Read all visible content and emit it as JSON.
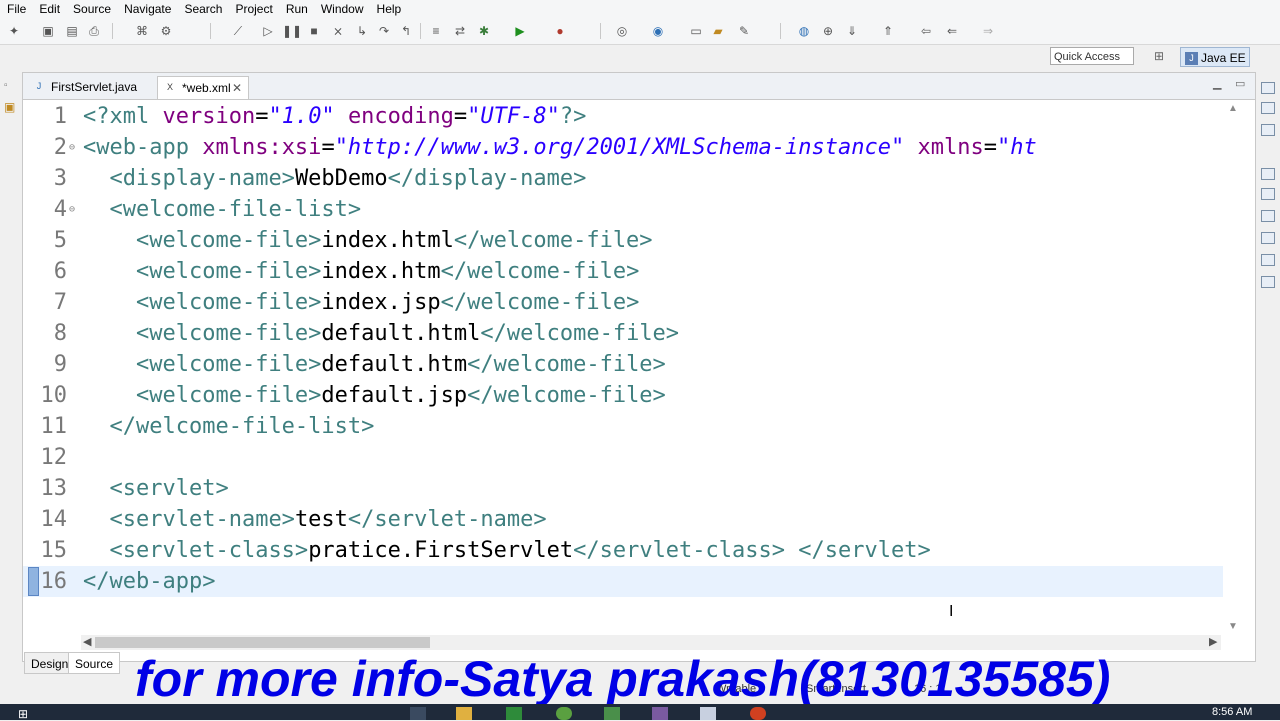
{
  "menu": [
    "File",
    "Edit",
    "Source",
    "Navigate",
    "Search",
    "Project",
    "Run",
    "Window",
    "Help"
  ],
  "toolbar": {
    "quick_access": "Quick Access",
    "perspective": "Java EE",
    "perspective_icon": "J"
  },
  "editor": {
    "tabs": [
      {
        "label": "FirstServlet.java",
        "icon": "java-file-icon",
        "active": false
      },
      {
        "label": "*web.xml",
        "icon": "xml-file-icon",
        "active": true
      }
    ],
    "lines": [
      {
        "n": "1",
        "tokens": [
          [
            "pi",
            "<?xml "
          ],
          [
            "a",
            "version"
          ],
          [
            "tx",
            "="
          ],
          [
            "v",
            "\"1.0\""
          ],
          [
            "tx",
            " "
          ],
          [
            "a",
            "encoding"
          ],
          [
            "tx",
            "="
          ],
          [
            "v",
            "\"UTF-8\""
          ],
          [
            "pi",
            "?>"
          ]
        ]
      },
      {
        "n": "2",
        "tokens": [
          [
            "t",
            "<web-app "
          ],
          [
            "a",
            "xmlns:xsi"
          ],
          [
            "tx",
            "="
          ],
          [
            "v",
            "\"http://www.w3.org/2001/XMLSchema-instance\""
          ],
          [
            "tx",
            " "
          ],
          [
            "a",
            "xmlns"
          ],
          [
            "tx",
            "="
          ],
          [
            "v",
            "\"ht"
          ]
        ]
      },
      {
        "n": "3",
        "tokens": [
          [
            "tx",
            "  "
          ],
          [
            "t",
            "<display-name>"
          ],
          [
            "tx",
            "WebDemo"
          ],
          [
            "t",
            "</display-name>"
          ]
        ]
      },
      {
        "n": "4",
        "tokens": [
          [
            "tx",
            "  "
          ],
          [
            "t",
            "<welcome-file-list>"
          ]
        ]
      },
      {
        "n": "5",
        "tokens": [
          [
            "tx",
            "    "
          ],
          [
            "t",
            "<welcome-file>"
          ],
          [
            "tx",
            "index.html"
          ],
          [
            "t",
            "</welcome-file>"
          ]
        ]
      },
      {
        "n": "6",
        "tokens": [
          [
            "tx",
            "    "
          ],
          [
            "t",
            "<welcome-file>"
          ],
          [
            "tx",
            "index.htm"
          ],
          [
            "t",
            "</welcome-file>"
          ]
        ]
      },
      {
        "n": "7",
        "tokens": [
          [
            "tx",
            "    "
          ],
          [
            "t",
            "<welcome-file>"
          ],
          [
            "tx",
            "index.jsp"
          ],
          [
            "t",
            "</welcome-file>"
          ]
        ]
      },
      {
        "n": "8",
        "tokens": [
          [
            "tx",
            "    "
          ],
          [
            "t",
            "<welcome-file>"
          ],
          [
            "tx",
            "default.html"
          ],
          [
            "t",
            "</welcome-file>"
          ]
        ]
      },
      {
        "n": "9",
        "tokens": [
          [
            "tx",
            "    "
          ],
          [
            "t",
            "<welcome-file>"
          ],
          [
            "tx",
            "default.htm"
          ],
          [
            "t",
            "</welcome-file>"
          ]
        ]
      },
      {
        "n": "10",
        "tokens": [
          [
            "tx",
            "    "
          ],
          [
            "t",
            "<welcome-file>"
          ],
          [
            "tx",
            "default.jsp"
          ],
          [
            "t",
            "</welcome-file>"
          ]
        ]
      },
      {
        "n": "11",
        "tokens": [
          [
            "tx",
            "  "
          ],
          [
            "t",
            "</welcome-file-list>"
          ]
        ]
      },
      {
        "n": "12",
        "tokens": []
      },
      {
        "n": "13",
        "tokens": [
          [
            "tx",
            "  "
          ],
          [
            "t",
            "<servlet>"
          ]
        ]
      },
      {
        "n": "14",
        "tokens": [
          [
            "tx",
            "  "
          ],
          [
            "t",
            "<servlet-name>"
          ],
          [
            "tx",
            "test"
          ],
          [
            "t",
            "</servlet-name>"
          ]
        ]
      },
      {
        "n": "15",
        "tokens": [
          [
            "tx",
            "  "
          ],
          [
            "t",
            "<servlet-class>"
          ],
          [
            "tx",
            "pratice.FirstServlet"
          ],
          [
            "t",
            "</servlet-class>"
          ],
          [
            "tx",
            " "
          ],
          [
            "t",
            "</servlet>"
          ]
        ]
      },
      {
        "n": "16",
        "tokens": [
          [
            "t",
            "</web-app>"
          ]
        ]
      }
    ]
  },
  "bottom_tabs": [
    "Design",
    "Source"
  ],
  "status": {
    "mode": "Writable",
    "insert": "Smart Insert",
    "position": "16 : 11"
  },
  "overlay_text": "for more info-Satya prakash(8130135585)",
  "taskbar": {
    "clock": "8:56 AM"
  },
  "colors": {
    "tag": "#3f7f7f",
    "attr": "#7f007f",
    "value": "#2a00ff",
    "overlay": "#0000e6"
  }
}
